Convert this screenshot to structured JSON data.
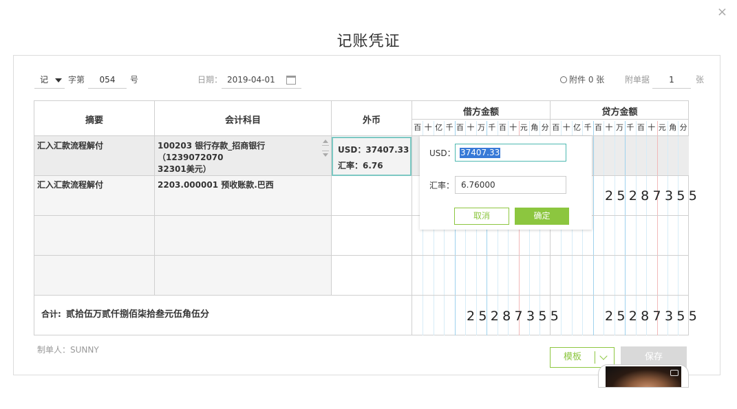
{
  "title": "记账凭证",
  "close_glyph": "×",
  "header": {
    "word_label": "记",
    "word_no_label": "字第",
    "number": "054",
    "number_suffix": "号",
    "date_label": "日期：",
    "date_value": "2019-04-01",
    "attachment_text": "附件 0 张",
    "doc_label": "附单据",
    "doc_count": "1",
    "doc_suffix": "张"
  },
  "table": {
    "col_summary": "摘要",
    "col_subject": "会计科目",
    "col_fx": "外币",
    "col_debit": "借方金额",
    "col_credit": "贷方金额",
    "digit_units": [
      "百",
      "十",
      "亿",
      "千",
      "百",
      "十",
      "万",
      "千",
      "百",
      "十",
      "元",
      "角",
      "分"
    ],
    "rows": [
      {
        "summary": "汇入汇款流程解付",
        "subject_line1": "100203 银行存款_招商银行（1239072070",
        "subject_line2": "32301美元）",
        "fx_line1": "USD：37407.33",
        "fx_line2": "汇率：6.76",
        "debit": "",
        "credit": ""
      },
      {
        "summary": "汇入汇款流程解付",
        "subject_line1": "2203.000001 预收账款.巴西",
        "subject_line2": "",
        "debit": "",
        "credit": "25287355"
      },
      {
        "summary": "",
        "subject_line1": "",
        "debit": "",
        "credit": ""
      },
      {
        "summary": "",
        "subject_line1": "",
        "debit": "",
        "credit": ""
      }
    ],
    "total_label": "合计:",
    "total_words": "贰拾伍万贰仟捌佰柒拾叁元伍角伍分",
    "total_debit": "25287355",
    "total_credit": "25287355"
  },
  "popup": {
    "usd_label": "USD：",
    "usd_value": "37407.33",
    "rate_label": "汇率：",
    "rate_value": "6.76000",
    "cancel_label": "取消",
    "ok_label": "确定"
  },
  "footer": {
    "maker": "制单人：SUNNY",
    "template_label": "模板",
    "save_label": "保存"
  },
  "colors": {
    "accent_green": "#8cc63f",
    "focus_teal": "#7cc8c3",
    "selection_blue": "#3779d7"
  }
}
